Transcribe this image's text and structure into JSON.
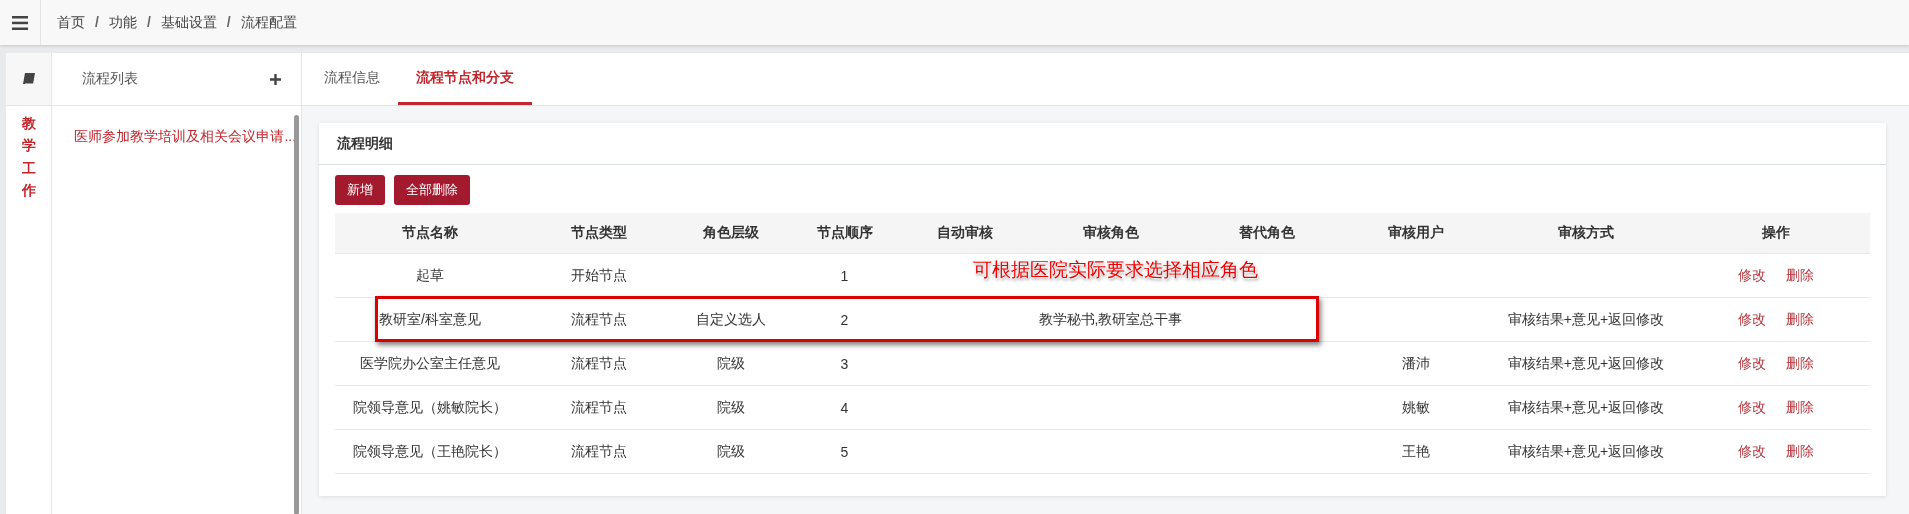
{
  "breadcrumb": [
    {
      "kind": "item",
      "text": "首页"
    },
    {
      "kind": "separator",
      "text": "/"
    },
    {
      "kind": "item",
      "text": "功能"
    },
    {
      "kind": "separator",
      "text": "/"
    },
    {
      "kind": "item",
      "text": "基础设置"
    },
    {
      "kind": "separator",
      "text": "/"
    },
    {
      "kind": "item",
      "text": "流程配置"
    }
  ],
  "category": {
    "label": "教学工作",
    "selected": true
  },
  "process_list": {
    "title": "流程列表",
    "items": [
      {
        "label": "医师参加教学培训及相关会议申请...",
        "selected": true
      }
    ]
  },
  "tabs": [
    {
      "label": "流程信息",
      "selected": false
    },
    {
      "label": "流程节点和分支",
      "selected": true
    }
  ],
  "card": {
    "title": "流程明细",
    "buttons": [
      "新增",
      "全部删除"
    ]
  },
  "table": {
    "columns": [
      "节点名称",
      "节点类型",
      "角色层级",
      "节点顺序",
      "自动审核",
      "审核角色",
      "替代角色",
      "审核用户",
      "审核方式",
      "操作"
    ],
    "rows": [
      {
        "name": "起草",
        "type": "开始节点",
        "order": "1",
        "highlighted": false,
        "actions": [
          "修改",
          "删除"
        ]
      },
      {
        "name": "教研室/科室意见",
        "type": "流程节点",
        "role_level": "自定义选人",
        "order": "2",
        "review_role": "教学秘书,教研室总干事",
        "review_method": "审核结果+意见+返回修改",
        "highlighted": true,
        "actions": [
          "修改",
          "删除"
        ]
      },
      {
        "name": "医学院办公室主任意见",
        "type": "流程节点",
        "role_level": "院级",
        "order": "3",
        "review_user": "潘沛",
        "review_method": "审核结果+意见+返回修改",
        "highlighted": false,
        "actions": [
          "修改",
          "删除"
        ]
      },
      {
        "name": "院领导意见（姚敏院长）",
        "type": "流程节点",
        "role_level": "院级",
        "order": "4",
        "review_user": "姚敏",
        "review_method": "审核结果+意见+返回修改",
        "highlighted": false,
        "actions": [
          "修改",
          "删除"
        ]
      },
      {
        "name": "院领导意见（王艳院长）",
        "type": "流程节点",
        "role_level": "院级",
        "order": "5",
        "review_user": "王艳",
        "review_method": "审核结果+意见+返回修改",
        "highlighted": false,
        "actions": [
          "修改",
          "删除"
        ]
      }
    ]
  },
  "annotation": {
    "text": "可根据医院实际要求选择相应角色"
  }
}
